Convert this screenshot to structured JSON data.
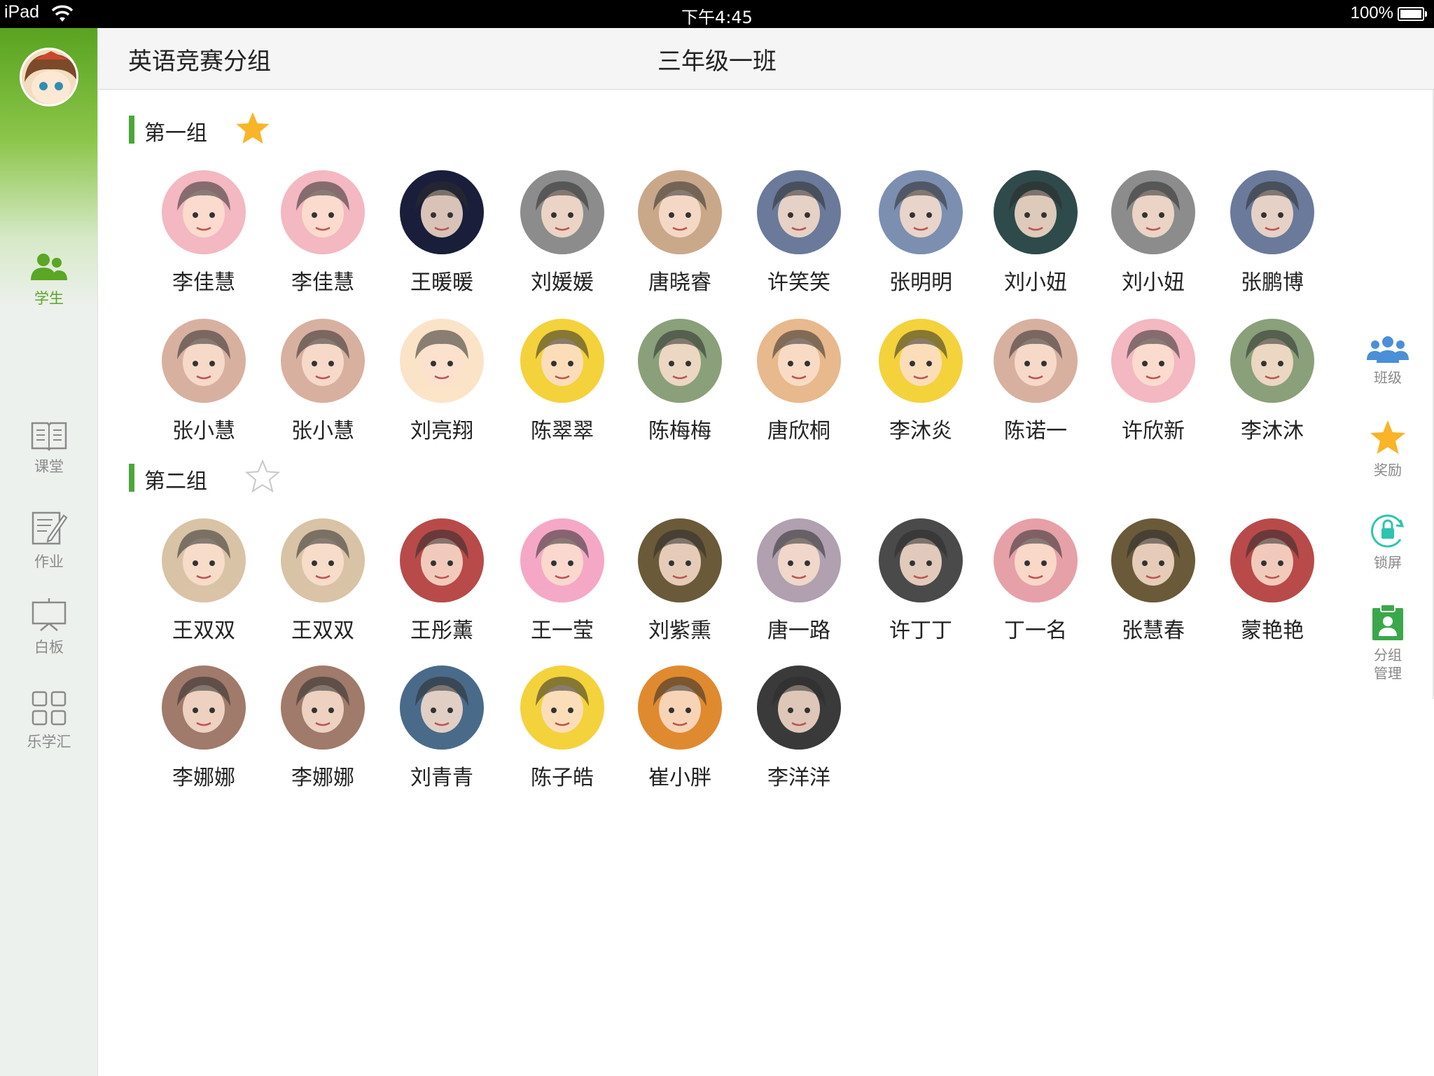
{
  "status_bar": {
    "device": "iPad",
    "time": "下午4:45",
    "battery": "100%"
  },
  "header": {
    "title": "英语竞赛分组",
    "class_name": "三年级一班"
  },
  "sidebar": {
    "items": [
      {
        "label": "学生",
        "icon": "students-icon",
        "active": true
      },
      {
        "label": "课堂",
        "icon": "book-icon",
        "active": false
      },
      {
        "label": "作业",
        "icon": "homework-icon",
        "active": false
      },
      {
        "label": "白板",
        "icon": "whiteboard-icon",
        "active": false
      },
      {
        "label": "乐学汇",
        "icon": "grid-icon",
        "active": false
      }
    ]
  },
  "groups": [
    {
      "name": "第一组",
      "starred": true,
      "students": [
        {
          "name": "李佳慧",
          "color": "#f3b8c2"
        },
        {
          "name": "李佳慧",
          "color": "#f3b8c2"
        },
        {
          "name": "王暖暖",
          "color": "#1a1e3a"
        },
        {
          "name": "刘媛媛",
          "color": "#8c8c8c"
        },
        {
          "name": "唐晓睿",
          "color": "#c9a88a"
        },
        {
          "name": "许笑笑",
          "color": "#6b7a9a"
        },
        {
          "name": "张明明",
          "color": "#7c8fb0"
        },
        {
          "name": "刘小妞",
          "color": "#2f4a4a"
        },
        {
          "name": "刘小妞",
          "color": "#8c8c8c"
        },
        {
          "name": "张鹏博",
          "color": "#6b7a9a"
        },
        {
          "name": "张小慧",
          "color": "#d8b0a0"
        },
        {
          "name": "张小慧",
          "color": "#d8b0a0"
        },
        {
          "name": "刘亮翔",
          "color": "#fbe3c8"
        },
        {
          "name": "陈翠翠",
          "color": "#f4d23c"
        },
        {
          "name": "陈梅梅",
          "color": "#8aa07a"
        },
        {
          "name": "唐欣桐",
          "color": "#e8b98c"
        },
        {
          "name": "李沐炎",
          "color": "#f4d23c"
        },
        {
          "name": "陈诺一",
          "color": "#d8b0a0"
        },
        {
          "name": "许欣新",
          "color": "#f3b8c2"
        },
        {
          "name": "李沐沐",
          "color": "#8aa07a"
        }
      ]
    },
    {
      "name": "第二组",
      "starred": false,
      "students": [
        {
          "name": "王双双",
          "color": "#d9c3a6"
        },
        {
          "name": "王双双",
          "color": "#d9c3a6"
        },
        {
          "name": "王彤薰",
          "color": "#b84a4a"
        },
        {
          "name": "王一莹",
          "color": "#f4a8c6"
        },
        {
          "name": "刘紫熏",
          "color": "#6a5a3a"
        },
        {
          "name": "唐一路",
          "color": "#b0a0b0"
        },
        {
          "name": "许丁丁",
          "color": "#4a4a4a"
        },
        {
          "name": "丁一名",
          "color": "#e6a0a8"
        },
        {
          "name": "张慧春",
          "color": "#6a5a3a"
        },
        {
          "name": "蒙艳艳",
          "color": "#b84a4a"
        },
        {
          "name": "李娜娜",
          "color": "#a07a6a"
        },
        {
          "name": "李娜娜",
          "color": "#a07a6a"
        },
        {
          "name": "刘青青",
          "color": "#4a6a8a"
        },
        {
          "name": "陈子皓",
          "color": "#f4d23c"
        },
        {
          "name": "崔小胖",
          "color": "#e08a30"
        },
        {
          "name": "李洋洋",
          "color": "#3a3a3a"
        }
      ]
    }
  ],
  "tools": [
    {
      "label": "班级",
      "icon": "class-icon"
    },
    {
      "label": "奖励",
      "icon": "star-icon"
    },
    {
      "label": "锁屏",
      "icon": "lock-icon"
    },
    {
      "label": "分组管理",
      "icon": "group-manage-icon"
    }
  ],
  "colors": {
    "accent": "#5aa625",
    "star": "#f9b428",
    "tool_blue": "#4a8fd8",
    "tool_teal": "#2ec4b0",
    "tool_green": "#3aa84a"
  }
}
